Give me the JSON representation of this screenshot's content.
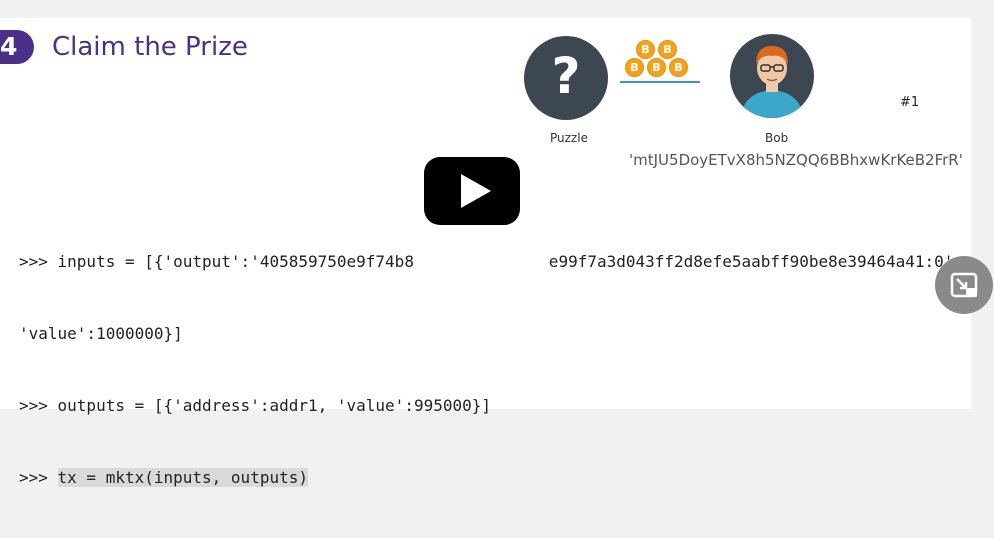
{
  "slide": {
    "step_number": "4",
    "title": "Claim the Prize"
  },
  "diagram": {
    "puzzle_symbol": "?",
    "puzzle_label": "Puzzle",
    "bob_label": "Bob",
    "slide_number": "#1",
    "address": "'mtJU5DoyETvX8h5NZQQ6BBhxwKrKeB2FrR'",
    "coin_symbol": "B",
    "colors": {
      "coin": "#f4a21c",
      "arrow": "#3a8fd9",
      "avatar_bg": "#3c4751",
      "title": "#4b2f88"
    }
  },
  "code": {
    "line1": ">>> inputs = [{'output':'405859750e9f74b8              e99f7a3d043ff2d8efe5aabff90be8e39464a41:0',",
    "line2": "'value':1000000}]",
    "line3": ">>> outputs = [{'address':addr1, 'value':995000}]",
    "line4_prompt": ">>> ",
    "line4_code": "tx = mktx(inputs, outputs)"
  },
  "player": {
    "play_icon": "play-icon",
    "pip_icon": "picture-in-picture-icon"
  }
}
